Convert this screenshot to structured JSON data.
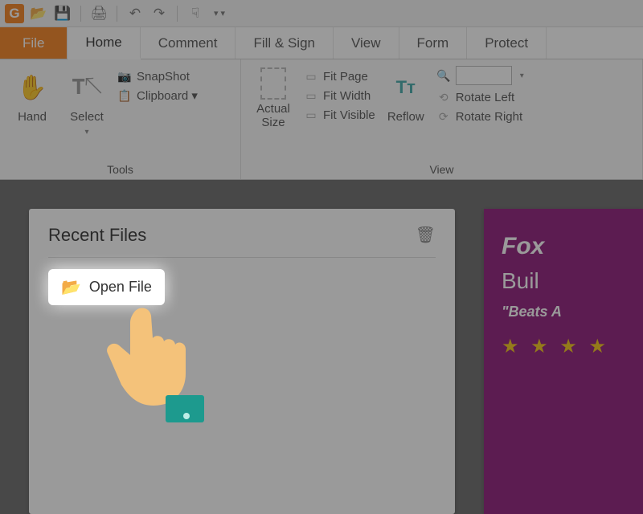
{
  "qat": {
    "foxit": "G"
  },
  "tabs": {
    "file": "File",
    "home": "Home",
    "comment": "Comment",
    "fillsign": "Fill & Sign",
    "view": "View",
    "form": "Form",
    "protect": "Protect"
  },
  "ribbon": {
    "tools_label": "Tools",
    "view_label": "View",
    "hand": "Hand",
    "select": "Select",
    "snapshot": "SnapShot",
    "clipboard": "Clipboard ▾",
    "actual": "Actual\nSize",
    "fitpage": "Fit Page",
    "fitwidth": "Fit Width",
    "fitvisible": "Fit Visible",
    "reflow": "Reflow",
    "rotatel": "Rotate Left",
    "rotater": "Rotate Right"
  },
  "recent": {
    "title": "Recent Files",
    "open": "Open File"
  },
  "promo": {
    "line1": "Fox",
    "line2": "Buil",
    "line3": "\"Beats A",
    "stars": "★ ★ ★ ★"
  }
}
